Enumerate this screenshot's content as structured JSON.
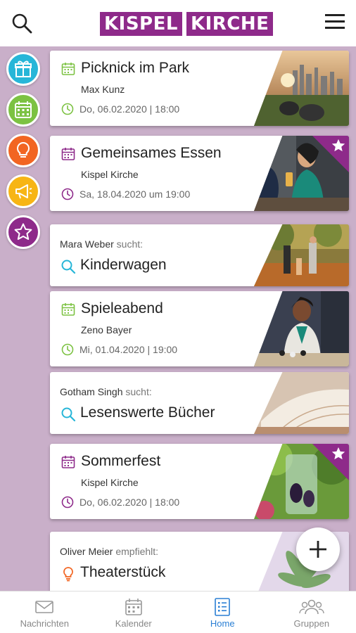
{
  "header": {
    "logo_word1": "KISPEL",
    "logo_word2": "KIRCHE",
    "search_icon": "search-icon",
    "menu_icon": "hamburger-menu-icon"
  },
  "categories": [
    {
      "name": "gift",
      "icon": "gift-icon",
      "color": "#27b6d8"
    },
    {
      "name": "calendar",
      "icon": "calendar-icon",
      "color": "#7cc242"
    },
    {
      "name": "idea",
      "icon": "lightbulb-icon",
      "color": "#f26522"
    },
    {
      "name": "announce",
      "icon": "megaphone-icon",
      "color": "#f7b515"
    },
    {
      "name": "recommend",
      "icon": "star-icon",
      "color": "#8e2a8a"
    }
  ],
  "feed": {
    "events": [
      {
        "title": "Picknick im Park",
        "organizer": "Max Kunz",
        "date": "Do, 06.02.2020 | 18:00",
        "color": "#7cc242"
      },
      {
        "title": "Gemeinsames Essen",
        "organizer": "Kispel Kirche",
        "date": "Sa, 18.04.2020 um 19:00",
        "color": "#8e2a8a"
      },
      {
        "title": "Spieleabend",
        "organizer": "Zeno Bayer",
        "date": "Mi, 01.04.2020 | 19:00",
        "color": "#7cc242"
      },
      {
        "title": "Sommerfest",
        "organizer": "Kispel Kirche",
        "date": "Do, 06.02.2020 | 18:00",
        "color": "#8e2a8a"
      }
    ],
    "requests": [
      {
        "user": "Mara Weber",
        "verb": "sucht:",
        "title": "Kinderwagen"
      },
      {
        "user": "Gotham Singh",
        "verb": "sucht:",
        "title": "Lesenswerte Bücher"
      }
    ],
    "recommendation": {
      "user": "Oliver Meier",
      "verb": "empfiehlt:",
      "title": "Theaterstück"
    }
  },
  "fab": {
    "icon": "plus-icon"
  },
  "bottom_nav": {
    "items": [
      {
        "label": "Nachrichten",
        "icon": "envelope-icon"
      },
      {
        "label": "Kalender",
        "icon": "calendar-icon"
      },
      {
        "label": "Home",
        "icon": "list-icon",
        "active": true
      },
      {
        "label": "Gruppen",
        "icon": "group-icon"
      }
    ],
    "active_color": "#2a7fd4"
  },
  "colors": {
    "brand": "#8e2a8a",
    "background": "#c9afc9",
    "search_icon": "#27b6d8"
  }
}
